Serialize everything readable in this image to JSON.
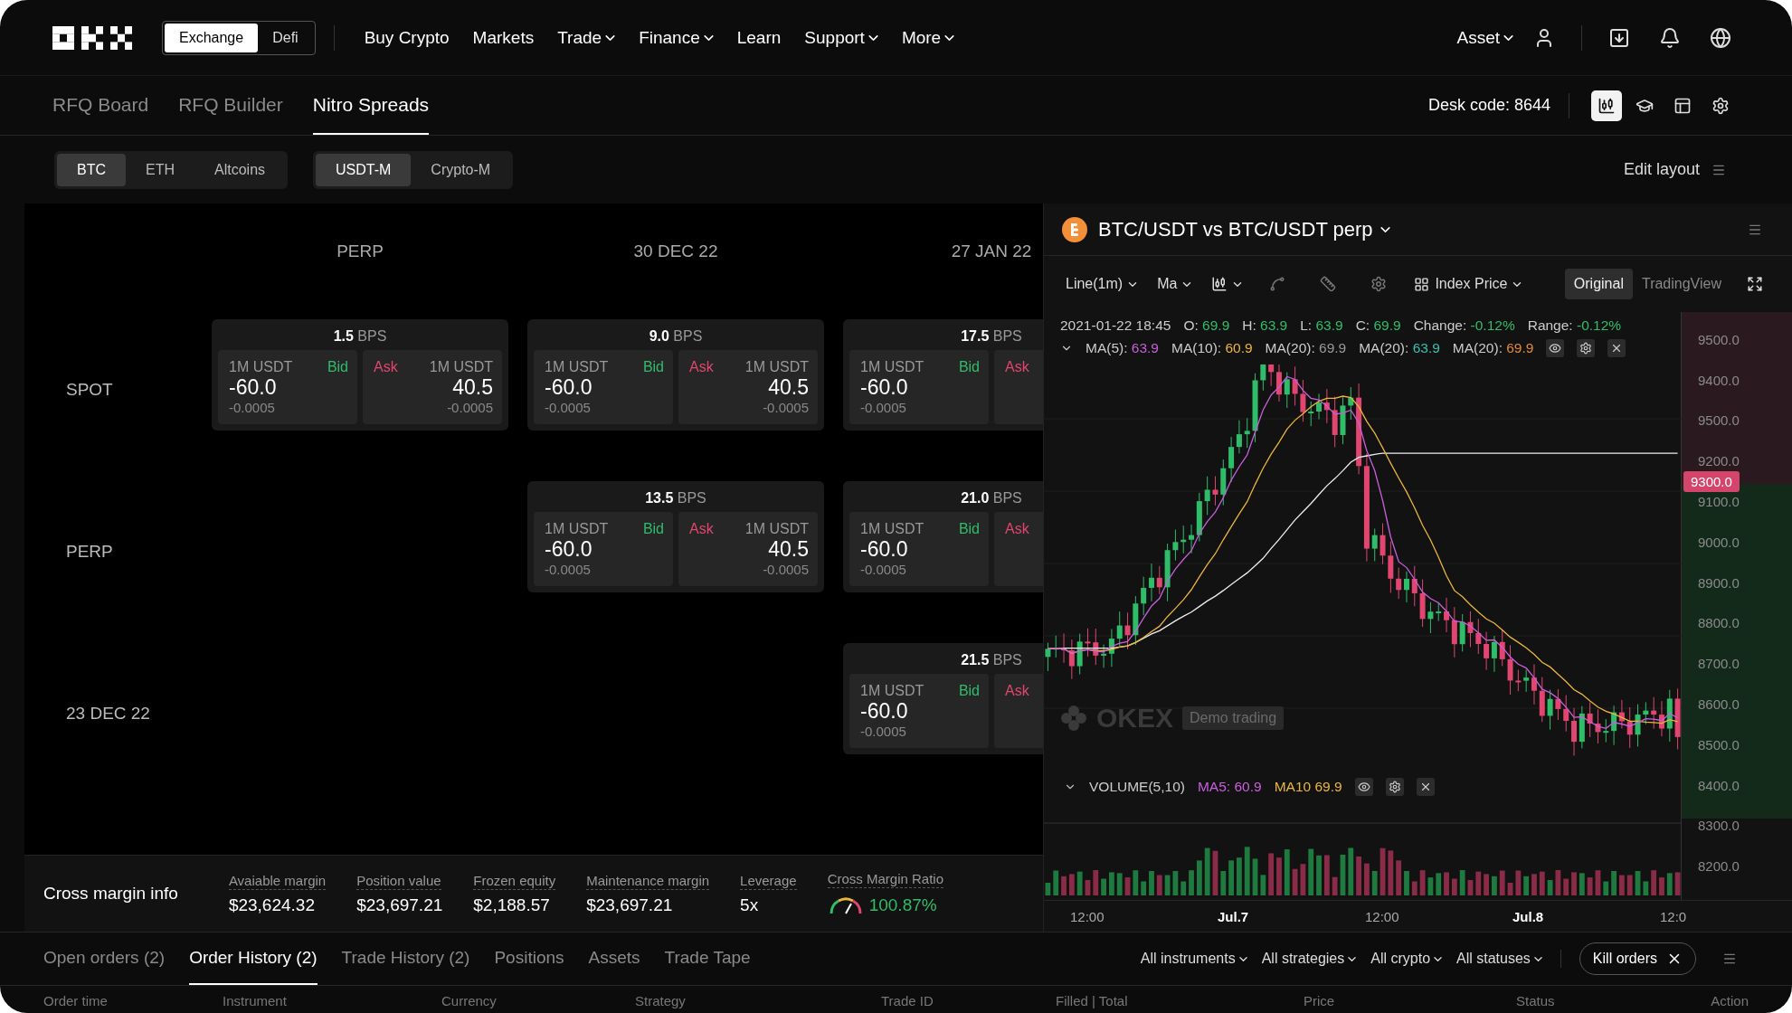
{
  "nav": {
    "modes": [
      {
        "label": "Exchange",
        "selected": true
      },
      {
        "label": "Defi",
        "selected": false
      }
    ],
    "menu": [
      {
        "label": "Buy Crypto",
        "dropdown": false
      },
      {
        "label": "Markets",
        "dropdown": false
      },
      {
        "label": "Trade",
        "dropdown": true
      },
      {
        "label": "Finance",
        "dropdown": true
      },
      {
        "label": "Learn",
        "dropdown": false
      },
      {
        "label": "Support",
        "dropdown": true
      },
      {
        "label": "More",
        "dropdown": true
      }
    ],
    "asset": "Asset"
  },
  "subnav": {
    "tabs": [
      {
        "label": "RFQ Board",
        "selected": false
      },
      {
        "label": "RFQ Builder",
        "selected": false
      },
      {
        "label": "Nitro Spreads",
        "selected": true
      }
    ],
    "desk_code": "Desk code: 8644",
    "tools": [
      {
        "kind": "candles",
        "selected": true
      },
      {
        "kind": "cap",
        "selected": false
      },
      {
        "kind": "layout",
        "selected": false
      },
      {
        "kind": "settings",
        "selected": false
      }
    ]
  },
  "filters": {
    "assets": [
      {
        "label": "BTC",
        "selected": true
      },
      {
        "label": "ETH",
        "selected": false
      },
      {
        "label": "Altcoins",
        "selected": false
      }
    ],
    "margins": [
      {
        "label": "USDT-M",
        "selected": true
      },
      {
        "label": "Crypto-M",
        "selected": false
      }
    ],
    "edit_layout": "Edit layout"
  },
  "grid": {
    "columns": [
      "PERP",
      "30 DEC 22",
      "27 JAN 22"
    ],
    "rows": [
      {
        "label": "SPOT",
        "cells": [
          {
            "kind": "quote",
            "spread": "**1.5** BPS",
            "bid": {
              "size": "1M USDT",
              "side": "Bid",
              "price": "-60.0",
              "change": "-0.0005"
            },
            "ask": {
              "side": "Ask",
              "size": "1M USDT",
              "price": "40.5",
              "change": "-0.0005"
            }
          },
          {
            "kind": "quote",
            "spread": "**9.0** BPS",
            "bid": {
              "size": "1M USDT",
              "side": "Bid",
              "price": "-60.0",
              "change": "-0.0005"
            },
            "ask": {
              "side": "Ask",
              "size": "1M USDT",
              "price": "40.5",
              "change": "-0.0005"
            }
          },
          {
            "kind": "quote",
            "spread": "**17.5** BPS",
            "bid": {
              "size": "1M USDT",
              "side": "Bid",
              "price": "-60.0",
              "change": "-0.0005"
            },
            "ask": {
              "side": "Ask"
            }
          }
        ]
      },
      {
        "label": "PERP",
        "cells": [
          {
            "kind": "empty"
          },
          {
            "kind": "quote",
            "spread": "**13.5** BPS",
            "bid": {
              "size": "1M USDT",
              "side": "Bid",
              "price": "-60.0",
              "change": "-0.0005"
            },
            "ask": {
              "side": "Ask",
              "size": "1M USDT",
              "price": "40.5",
              "change": "-0.0005"
            }
          },
          {
            "kind": "quote",
            "spread": "**21.0** BPS",
            "bid": {
              "size": "1M USDT",
              "side": "Bid",
              "price": "-60.0",
              "change": "-0.0005"
            },
            "ask": {
              "side": "Ask"
            }
          }
        ]
      },
      {
        "label": "23 DEC 22",
        "cells": [
          {
            "kind": "empty"
          },
          {
            "kind": "empty"
          },
          {
            "kind": "quote",
            "spread": "**21.5** BPS",
            "bid": {
              "size": "1M USDT",
              "side": "Bid",
              "price": "-60.0",
              "change": "-0.0005"
            },
            "ask": {
              "side": "Ask"
            }
          }
        ]
      }
    ]
  },
  "margin_info": {
    "title": "Cross margin info",
    "metrics": [
      {
        "kind": "plain",
        "label": "Avaiable margin",
        "value": "$23,624.32"
      },
      {
        "kind": "plain",
        "label": "Position value",
        "value": "$23,697.21"
      },
      {
        "kind": "plain",
        "label": "Frozen equity",
        "value": "$2,188.57"
      },
      {
        "kind": "plain",
        "label": "Maintenance margin",
        "value": "$23,697.21"
      },
      {
        "kind": "plain",
        "label": "Leverage",
        "value": "5x"
      },
      {
        "kind": "gauge",
        "label": "Cross Margin Ratio",
        "value": "100.87%"
      }
    ]
  },
  "chart": {
    "pair": "BTC/USDT vs BTC/USDT perp",
    "toolbar": [
      {
        "kind": "select",
        "label": "Line(1m)"
      },
      {
        "kind": "select",
        "label": "Ma"
      },
      {
        "kind": "candles-select"
      },
      {
        "kind": "wave"
      },
      {
        "kind": "ruler"
      },
      {
        "kind": "settings"
      },
      {
        "kind": "index-select",
        "label": "Index Price"
      }
    ],
    "views": [
      {
        "label": "Original",
        "selected": true
      },
      {
        "label": "TradingView",
        "selected": false
      }
    ],
    "ohlc": {
      "time": "2021-01-22 18:45",
      "fields": [
        {
          "label": "O:",
          "value": "69.9"
        },
        {
          "label": "H:",
          "value": "63.9"
        },
        {
          "label": "L:",
          "value": "63.9"
        },
        {
          "label": "C:",
          "value": "69.9"
        },
        {
          "label": "Change:",
          "value": "-0.12%"
        },
        {
          "label": "Range:",
          "value": "-0.12%"
        }
      ]
    },
    "ma": [
      {
        "label": "MA(5):",
        "value": "63.9",
        "color": "#c95fdc"
      },
      {
        "label": "MA(10):",
        "value": "60.9",
        "color": "#eab53b"
      },
      {
        "label": "MA(20):",
        "value": "69.9",
        "color": "#9a9a9a"
      },
      {
        "label": "MA(20):",
        "value": "63.9",
        "color": "#3bbfb0"
      },
      {
        "label": "MA(20):",
        "value": "69.9",
        "color": "#e0883e"
      }
    ],
    "watermark": {
      "brand": "OKEX",
      "tag": "Demo trading"
    },
    "volume": {
      "label": "VOLUME(5,10)",
      "ma": [
        {
          "label": "MA5:",
          "value": "60.9",
          "color": "#c95fdc"
        },
        {
          "label": "MA10",
          "value": "69.9",
          "color": "#eab53b"
        }
      ]
    },
    "price_axis": [
      "9500.0",
      "9400.0",
      "9500.0",
      "9200.0",
      "9100.0",
      "9000.0",
      "8900.0",
      "8800.0",
      "8700.0",
      "8600.0",
      "8500.0",
      "8400.0",
      "8300.0",
      "8200.0"
    ],
    "price_marker": "9300.0",
    "time_axis": [
      {
        "label": "12:00",
        "major": false
      },
      {
        "label": "Jul.7",
        "major": true
      },
      {
        "label": "12:00",
        "major": false
      },
      {
        "label": "Jul.8",
        "major": true
      },
      {
        "label": "12:0",
        "major": false
      }
    ]
  },
  "orders": {
    "tabs": [
      {
        "label": "Open orders (2)",
        "selected": false
      },
      {
        "label": "Order History (2)",
        "selected": true
      },
      {
        "label": "Trade History (2)",
        "selected": false
      },
      {
        "label": "Positions",
        "selected": false
      },
      {
        "label": "Assets",
        "selected": false
      },
      {
        "label": "Trade Tape",
        "selected": false
      }
    ],
    "filters": [
      "All instruments",
      "All strategies",
      "All crypto",
      "All statuses"
    ],
    "kill": "Kill orders",
    "columns": [
      "Order time",
      "Instrument",
      "Currency",
      "Strategy",
      "Trade ID",
      "Filled | Total",
      "Price",
      "Status",
      "Action"
    ]
  }
}
